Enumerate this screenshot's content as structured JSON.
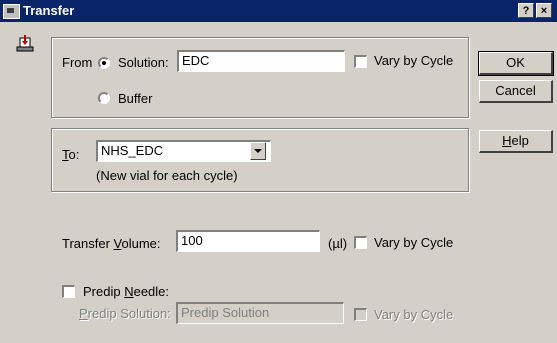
{
  "window": {
    "title": "Transfer",
    "help_btn": "?",
    "close_btn": "×"
  },
  "from": {
    "label": "From",
    "solution_label": "Solution:",
    "solution_value": "EDC",
    "solution_selected": true,
    "buffer_label": "Buffer",
    "vary_label": "Vary by Cycle"
  },
  "to": {
    "label": "To:",
    "value": "NHS_EDC",
    "note": "(New vial for each cycle)"
  },
  "transfer": {
    "label": "Transfer Volume:",
    "value": "100",
    "unit": "(µl)",
    "vary_label": "Vary by Cycle"
  },
  "predip": {
    "needle_label": "Predip Needle:",
    "solution_label": "Predip Solution:",
    "solution_value": "Predip Solution",
    "vary_label": "Vary by Cycle"
  },
  "buttons": {
    "ok": "OK",
    "cancel": "Cancel",
    "help": "Help"
  }
}
